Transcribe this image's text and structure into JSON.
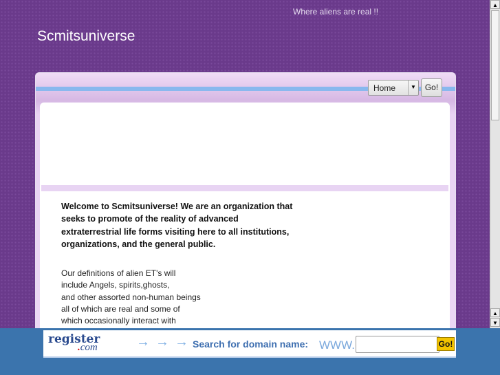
{
  "header": {
    "tagline": "Where aliens are real !!",
    "site_title": "Scmitsuniverse"
  },
  "nav": {
    "select_value": "Home",
    "go_label": "Go!"
  },
  "content": {
    "welcome": "Welcome to Scmitsuniverse! We are an organization that seeks to promote of the reality of advanced extraterrestrial life forms visiting here to all institutions, organizations, and the general public.",
    "definitions": [
      "Our definitions of alien ET's will",
      "include Angels, spirits,ghosts,",
      "and other assorted non-human beings",
      "all of which are real and some of",
      "which occasionally interact with"
    ]
  },
  "banner": {
    "logo_main": "register",
    "logo_dot": ".",
    "logo_com": "com",
    "arrows": "→→→",
    "search_label": "Search for domain name:",
    "www": "WWW.",
    "domain_value": "",
    "go_label": "Go!"
  },
  "colors": {
    "background": "#6a3a8b",
    "stripe": "#88b8ee",
    "footer": "#3b74ad"
  }
}
